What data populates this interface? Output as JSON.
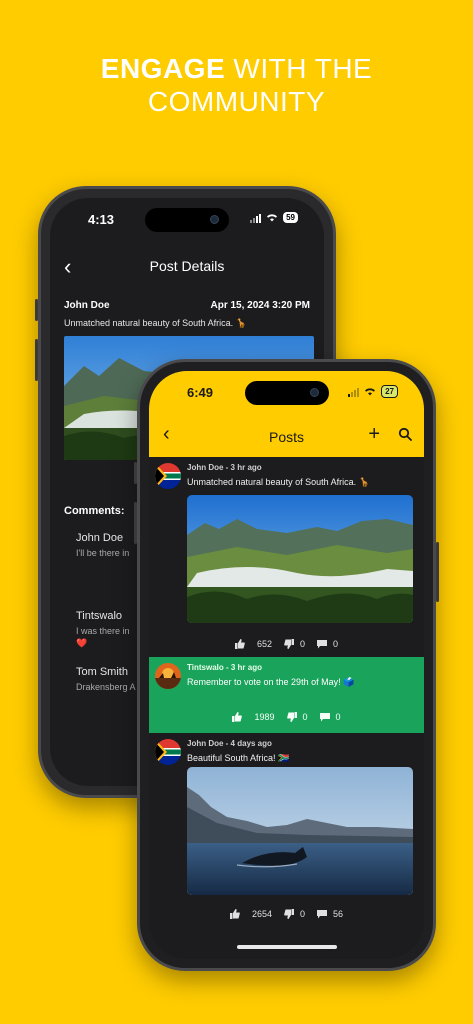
{
  "headline": {
    "bold": "ENGAGE",
    "rest": " WITH THE",
    "line2": "COMMUNITY"
  },
  "back_phone": {
    "status_time": "4:13",
    "battery": "59",
    "nav_title": "Post Details",
    "post": {
      "author": "John Doe",
      "datetime": "Apr 15, 2024 3:20 PM",
      "text": "Unmatched natural beauty of South Africa. 🦒"
    },
    "comments_heading": "Comments:",
    "comments": [
      {
        "author": "John Doe",
        "text": "I'll be there in"
      },
      {
        "author": "Tintswalo",
        "text": "I was there in",
        "extra": "❤️"
      },
      {
        "author": "Tom Smith",
        "text": "Drakensberg A"
      }
    ]
  },
  "front_phone": {
    "status_time": "6:49",
    "battery": "27",
    "nav_title": "Posts",
    "posts": [
      {
        "meta": "John Doe - 3 hr ago",
        "text": "Unmatched natural beauty of South Africa. 🦒",
        "likes": "652",
        "dislikes": "0",
        "comments": "0"
      },
      {
        "meta": "Tintswalo  - 3 hr ago",
        "text": "Remember to vote on the 29th of May! 🗳️",
        "likes": "1989",
        "dislikes": "0",
        "comments": "0"
      },
      {
        "meta": "John Doe - 4 days ago",
        "text": "Beautiful South Africa! 🇿🇦",
        "likes": "2654",
        "dislikes": "0",
        "comments": "56"
      }
    ]
  },
  "colors": {
    "brand_yellow": "#FFCC00",
    "highlight_green": "#1aa35b",
    "dark_bg": "#1c1c1e"
  }
}
